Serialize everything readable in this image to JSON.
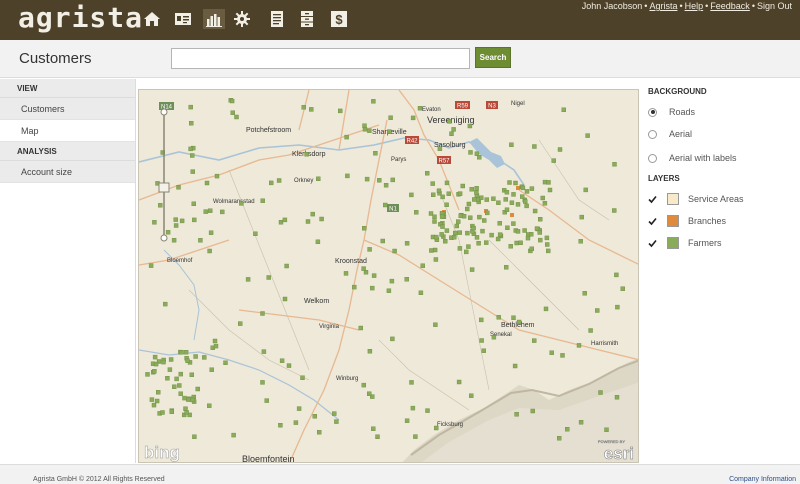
{
  "app": {
    "logo": "agrista",
    "user_name": "John Jacobson",
    "links": [
      "Agrista",
      "Help",
      "Feedback",
      "Sign Out"
    ]
  },
  "nav_icons": [
    "home-icon",
    "contacts-card-icon",
    "bar-chart-icon",
    "gear-icon",
    "document-icon",
    "cabinet-icon",
    "dollar-icon"
  ],
  "page": {
    "title": "Customers"
  },
  "search": {
    "value": "",
    "placeholder": "",
    "button_label": "Search"
  },
  "sidebar": {
    "sections": [
      {
        "title": "VIEW",
        "items": [
          {
            "label": "Customers",
            "active": true
          },
          {
            "label": "Map",
            "active": false
          }
        ]
      },
      {
        "title": "ANALYSIS",
        "items": [
          {
            "label": "Account size",
            "active": true
          }
        ]
      }
    ]
  },
  "map": {
    "places": [
      "Vereeniging",
      "Potchefstroom",
      "Sharpeville",
      "Sasolburg",
      "Parys",
      "Evaton",
      "Nigel",
      "Klerksdorp",
      "Wolmaransstad",
      "Orkney",
      "Bloemhof",
      "Kroonstad",
      "Welkom",
      "Virginia",
      "Senekal",
      "Winburg",
      "Bethlehem",
      "Harrismith",
      "Ficksburg",
      "Bloemfontein"
    ],
    "road_labels": [
      "R59",
      "N3",
      "R42",
      "R57",
      "N1",
      "N14"
    ],
    "attribution_left": "bing",
    "attribution_right": "esri",
    "attribution_right_small": "POWERED BY"
  },
  "layers_panel": {
    "background_title": "BACKGROUND",
    "background_options": [
      {
        "label": "Roads",
        "selected": true
      },
      {
        "label": "Aerial",
        "selected": false
      },
      {
        "label": "Aerial with labels",
        "selected": false
      }
    ],
    "layers_title": "LAYERS",
    "layers": [
      {
        "label": "Service Areas",
        "checked": true,
        "color": "#f7e9c9"
      },
      {
        "label": "Branches",
        "checked": true,
        "color": "#e08a3c"
      },
      {
        "label": "Farmers",
        "checked": true,
        "color": "#8aab5a"
      }
    ]
  },
  "footer": {
    "copyright": "Agrista GmbH © 2012 All Rights Reserved",
    "company_link": "Company Information"
  },
  "colors": {
    "topbar": "#4e4129",
    "accent": "#6e8c32",
    "farmer": "#8aab5a",
    "branch": "#e08a3c"
  }
}
